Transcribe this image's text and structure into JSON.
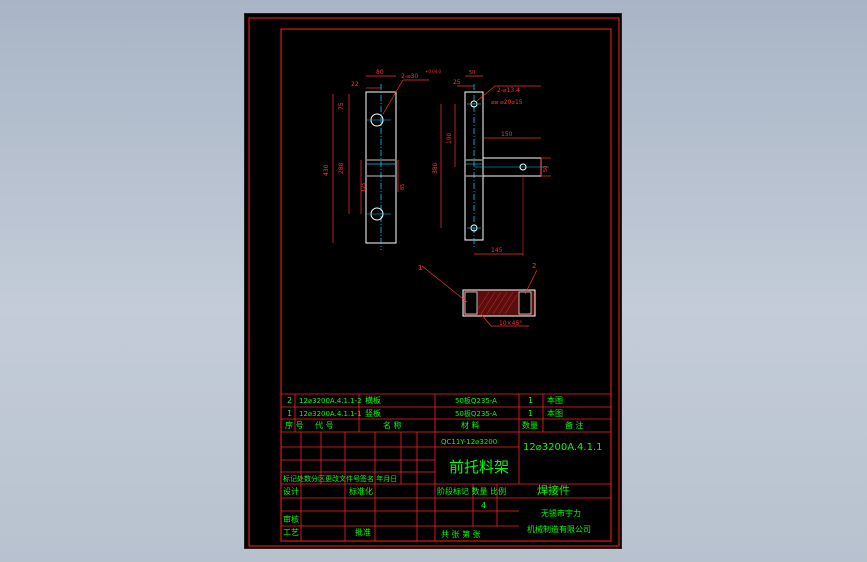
{
  "colors": {
    "background": "#b7c1cf",
    "sheet": "#000000",
    "frame": "#ff2020",
    "text": "#00ff00",
    "part": "#ffffff",
    "centerline": "#00c8ff",
    "dimension": "#ff3030",
    "hatch": "#b02020"
  },
  "drawing": {
    "dims": {
      "w80": "80",
      "w22": "22",
      "hole_left": "2-⌀30",
      "hole_left_tol": "+0.04 0",
      "h75": "75",
      "h280": "280",
      "h430": "430",
      "h125": "125",
      "h85": "85",
      "w50": "50",
      "w25": "25",
      "hole_right_1": "2-⌀13.4",
      "hole_right_2": "⌀⌀ ⌀20⌀15",
      "w150": "150",
      "h380": "380",
      "h190": "190",
      "w145": "145",
      "h50": "50",
      "weld_note": "10×45°"
    },
    "balloons": [
      "1",
      "2"
    ]
  },
  "bom": {
    "rows": [
      {
        "no": "2",
        "code": "12⌀3200A.4.1.1-2",
        "name": "横板",
        "material": "50板Q235-A",
        "qty": "1",
        "note": "本图"
      },
      {
        "no": "1",
        "code": "12⌀3200A.4.1.1-1",
        "name": "竖板",
        "material": "50板Q235-A",
        "qty": "1",
        "note": "本图"
      }
    ],
    "header": {
      "no": "序 号",
      "code": "代  号",
      "name": "名  称",
      "material": "材  料",
      "qty": "数量",
      "note": "备  注"
    }
  },
  "title_block": {
    "project_code": "QC11Y-12⌀3200",
    "drawing_title": "前托料架",
    "drawing_number": "12⌀3200A.4.1.1",
    "part_type": "焊接件",
    "company_line1": "无锡市宇力",
    "company_line2": "机械制造有限公司",
    "rev_header": "标记处数分区更改文件号签名 年月日",
    "design": "设计",
    "standardize": "标准化",
    "review": "审核",
    "process": "工艺",
    "approve": "批准",
    "stage_header": "阶段标记 数量 比例",
    "quantity": "4",
    "sheet_footer": "共  张  第  张"
  }
}
